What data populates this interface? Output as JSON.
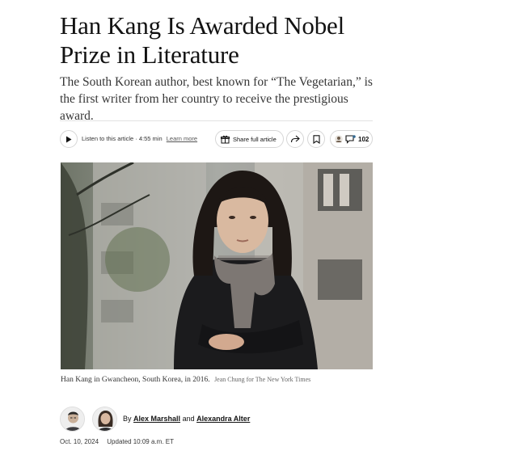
{
  "article": {
    "headline": "Han Kang Is Awarded Nobel Prize in Literature",
    "summary": "The South Korean author, best known for “The Vegetarian,” is the first writer from her country to receive the prestigious award."
  },
  "toolbar": {
    "listen_label": "Listen to this article · 4:55 min",
    "learn_more": "Learn more",
    "share_full_label": "Share full article",
    "comment_count": "102"
  },
  "photo": {
    "caption": "Han Kang in Gwancheon, South Korea, in 2016.",
    "credit": "Jean Chung for The New York Times"
  },
  "byline": {
    "prefix": "By",
    "author1": "Alex Marshall",
    "conjunction": "and",
    "author2": "Alexandra Alter"
  },
  "dates": {
    "published": "Oct. 10, 2024",
    "updated": "Updated 10:09 a.m. ET"
  },
  "icons": [
    "play-icon",
    "gift-icon",
    "share-icon",
    "bookmark-icon",
    "comment-icon"
  ]
}
